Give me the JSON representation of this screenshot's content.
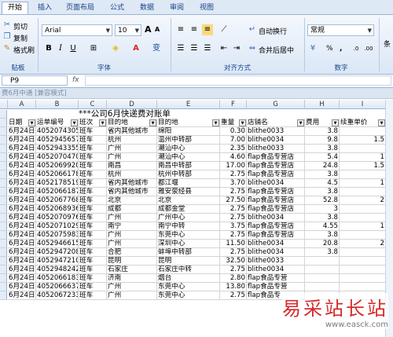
{
  "ribbon_tabs": [
    "开始",
    "插入",
    "页面布局",
    "公式",
    "数据",
    "审阅",
    "视图"
  ],
  "clipboard": {
    "cut": "剪切",
    "copy": "复制",
    "format_painter": "格式刷",
    "label": "贴板"
  },
  "font": {
    "name": "Arial",
    "size": "10",
    "label": "字体",
    "size_up": "A",
    "size_down": "A"
  },
  "alignment": {
    "wrap": "自动换行",
    "merge": "合并后居中",
    "label": "对齐方式"
  },
  "number": {
    "format": "常规",
    "percent": "%",
    "comma": ",",
    "label": "数字"
  },
  "styles_label": "条",
  "name_box": "P9",
  "formula_fx": "fx",
  "workbook_title": "费6月中通 [兼容模式]",
  "column_headers": [
    "A",
    "B",
    "C",
    "D",
    "E",
    "F",
    "G",
    "H",
    "I"
  ],
  "sheet_title": "***公司6月快递费对账单",
  "table_headers": [
    "日期",
    "运单编号",
    "班次",
    "目的地",
    "目的地",
    "重量",
    "店铺名",
    "费用",
    "续重单价"
  ],
  "rows": [
    [
      "6月24日",
      "4052074305",
      "班车",
      "省内其他城市",
      "绵阳",
      "0.30",
      "blithe0033",
      "3.8",
      ""
    ],
    [
      "6月24日",
      "4052945657",
      "班车",
      "杭州",
      "温州中转部",
      "7.00",
      "blithe0034",
      "9.8",
      "1.5"
    ],
    [
      "6月24日",
      "4052943355",
      "班车",
      "广州",
      "潮汕中心",
      "2.35",
      "blithe0033",
      "3.8",
      ""
    ],
    [
      "6月24日",
      "4052070470",
      "班车",
      "广州",
      "潮汕中心",
      "4.60",
      "flap食品专营店",
      "5.4",
      "1"
    ],
    [
      "6月24日",
      "4052069920",
      "班车",
      "南昌",
      "南昌中转部",
      "17.00",
      "flap食品专营店",
      "24.8",
      "1.5"
    ],
    [
      "6月24日",
      "4052066178",
      "班车",
      "杭州",
      "杭州中转部",
      "2.75",
      "flap食品专营店",
      "3.8",
      ""
    ],
    [
      "6月24日",
      "4052178519",
      "班车",
      "省内其他城市",
      "都江堰",
      "3.70",
      "blithe0034",
      "4.5",
      "1"
    ],
    [
      "6月24日",
      "4052066187",
      "班车",
      "省内其他城市",
      "雅安荥经县",
      "2.75",
      "flap食品专营店",
      "3.8",
      ""
    ],
    [
      "6月24日",
      "4052067768",
      "班车",
      "北京",
      "北京",
      "27.50",
      "flap食品专营店",
      "52.8",
      "2"
    ],
    [
      "6月24日",
      "4052068936",
      "班车",
      "成都",
      "成都金堂",
      "2.75",
      "flap食品专营店",
      "3",
      ""
    ],
    [
      "6月24日",
      "4052070976",
      "班车",
      "广州",
      "广州中心",
      "2.75",
      "blithe0034",
      "3.8",
      ""
    ],
    [
      "6月24日",
      "4052071029",
      "班车",
      "南宁",
      "南宁中转",
      "3.75",
      "flap食品专营店",
      "4.55",
      "1"
    ],
    [
      "6月24日",
      "4052075983",
      "班车",
      "广州",
      "东莞中心",
      "2.75",
      "flap食品专营店",
      "3.8",
      ""
    ],
    [
      "6月24日",
      "4052946615",
      "班车",
      "广州",
      "深圳中心",
      "11.50",
      "blithe0034",
      "20.8",
      "2"
    ],
    [
      "6月24日",
      "4052947208",
      "班车",
      "合肥",
      "蚌埠中转部",
      "2.75",
      "blithe0034",
      "3.8",
      ""
    ],
    [
      "6月24日",
      "4052947210",
      "班车",
      "昆明",
      "昆明",
      "32.50",
      "blithe0033",
      "",
      ""
    ],
    [
      "6月24日",
      "4052948242",
      "班车",
      "石家庄",
      "石家庄中转",
      "2.75",
      "blithe0034",
      "",
      ""
    ],
    [
      "6月24日",
      "4052066183",
      "班车",
      "济南",
      "烟台",
      "2.80",
      "flap食品专营",
      "",
      ""
    ],
    [
      "6月24日",
      "4052066637",
      "班车",
      "广州",
      "东莞中心",
      "13.80",
      "flap食品专营",
      "",
      ""
    ],
    [
      "6月24日",
      "4052067233",
      "班车",
      "广州",
      "东莞中心",
      "2.75",
      "flap食品专",
      "",
      ""
    ]
  ],
  "watermark": {
    "cn": "易采站长站",
    "url": "www.easck.com"
  },
  "colors": {
    "ribbon_bg": "#dbe7f6",
    "tab_text": "#15428b",
    "watermark": "#d62a2a"
  }
}
